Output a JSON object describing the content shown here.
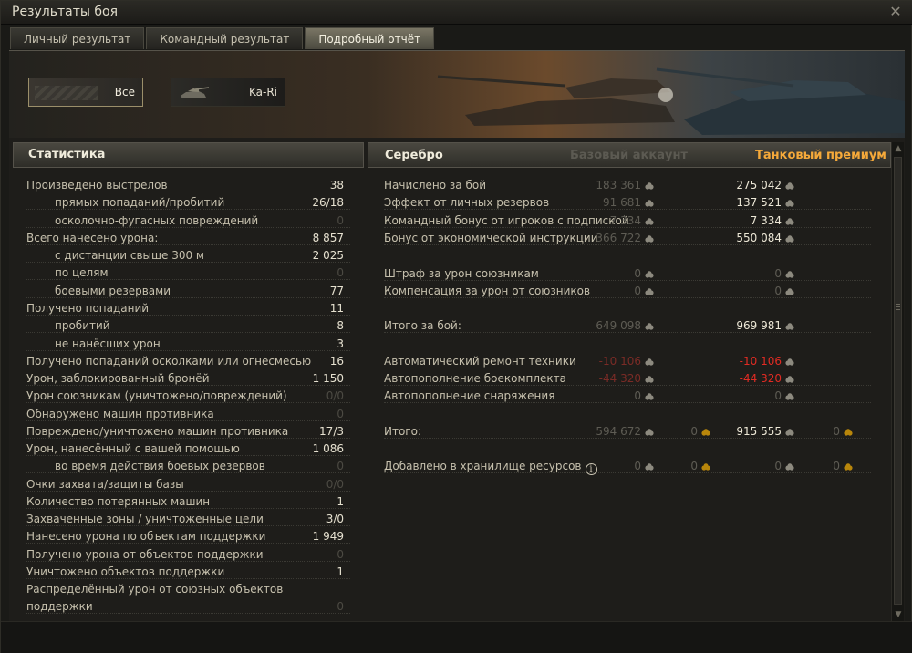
{
  "window": {
    "title": "Результаты боя"
  },
  "tabs": [
    {
      "label": "Личный результат",
      "active": false
    },
    {
      "label": "Командный результат",
      "active": false
    },
    {
      "label": "Подробный отчёт",
      "active": true
    }
  ],
  "filters": [
    {
      "label": "Все",
      "selected": true
    },
    {
      "label": "Ka-Ri",
      "selected": false
    }
  ],
  "stats": {
    "header": "Статистика",
    "rows": [
      {
        "label": "Произведено выстрелов",
        "value": "38",
        "sub": false,
        "dim": false
      },
      {
        "label": "прямых попаданий/пробитий",
        "value": "26/18",
        "sub": true,
        "dim": false
      },
      {
        "label": "осколочно-фугасных повреждений",
        "value": "0",
        "sub": true,
        "dim": true
      },
      {
        "label": "Всего нанесено урона:",
        "value": "8 857",
        "sub": false,
        "dim": false
      },
      {
        "label": "с дистанции свыше 300 м",
        "value": "2 025",
        "sub": true,
        "dim": false
      },
      {
        "label": "по целям",
        "value": "0",
        "sub": true,
        "dim": true
      },
      {
        "label": "боевыми резервами",
        "value": "77",
        "sub": true,
        "dim": false
      },
      {
        "label": "Получено попаданий",
        "value": "11",
        "sub": false,
        "dim": false
      },
      {
        "label": "пробитий",
        "value": "8",
        "sub": true,
        "dim": false
      },
      {
        "label": "не нанёсших урон",
        "value": "3",
        "sub": true,
        "dim": false
      },
      {
        "label": "Получено попаданий осколками или огнесмесью",
        "value": "16",
        "sub": false,
        "dim": false
      },
      {
        "label": "Урон, заблокированный бронёй",
        "value": "1 150",
        "sub": false,
        "dim": false
      },
      {
        "label": "Урон союзникам (уничтожено/повреждений)",
        "value": "0/0",
        "sub": false,
        "dim": true
      },
      {
        "label": "Обнаружено машин противника",
        "value": "0",
        "sub": false,
        "dim": true
      },
      {
        "label": "Повреждено/уничтожено машин противника",
        "value": "17/3",
        "sub": false,
        "dim": false
      },
      {
        "label": "Урон, нанесённый с вашей помощью",
        "value": "1 086",
        "sub": false,
        "dim": false
      },
      {
        "label": "во время действия боевых резервов",
        "value": "0",
        "sub": true,
        "dim": true
      },
      {
        "label": "Очки захвата/защиты базы",
        "value": "0/0",
        "sub": false,
        "dim": true
      },
      {
        "label": "Количество потерянных машин",
        "value": "1",
        "sub": false,
        "dim": false
      },
      {
        "label": "Захваченные зоны / уничтоженные цели",
        "value": "3/0",
        "sub": false,
        "dim": false
      },
      {
        "label": "Нанесено урона по объектам поддержки",
        "value": "1 949",
        "sub": false,
        "dim": false
      },
      {
        "label": "Получено урона от объектов поддержки",
        "value": "0",
        "sub": false,
        "dim": true
      },
      {
        "label": "Уничтожено объектов поддержки",
        "value": "1",
        "sub": false,
        "dim": false
      },
      {
        "label": "Распределённый урон от союзных объектов",
        "value": "",
        "sub": false,
        "dim": false
      },
      {
        "label": "поддержки",
        "value": "0",
        "sub": false,
        "dim": true
      }
    ]
  },
  "silver": {
    "header": "Серебро",
    "col_base": "Базовый аккаунт",
    "col_premium": "Танковый премиум",
    "rows": [
      {
        "label": "Начислено за бой",
        "base": "183 361",
        "premium": "275 042",
        "base_red": false,
        "prem_red": false,
        "prem_dim": false
      },
      {
        "label": "Эффект от личных резервов",
        "base": "91 681",
        "premium": "137 521",
        "base_red": false,
        "prem_red": false,
        "prem_dim": false
      },
      {
        "label": "Командный бонус от игроков с подпиской",
        "base": "7 334",
        "premium": "7 334",
        "base_red": false,
        "prem_red": false,
        "prem_dim": false
      },
      {
        "label": "Бонус от экономической инструкции",
        "base": "366 722",
        "premium": "550 084",
        "base_red": false,
        "prem_red": false,
        "prem_dim": false
      },
      {
        "label": "Штраф за урон союзникам",
        "base": "0",
        "premium": "0",
        "base_red": false,
        "prem_red": false,
        "prem_dim": true
      },
      {
        "label": "Компенсация за урон от союзников",
        "base": "0",
        "premium": "0",
        "base_red": false,
        "prem_red": false,
        "prem_dim": true
      },
      {
        "label": "Итого за бой:",
        "base": "649 098",
        "premium": "969 981",
        "base_red": false,
        "prem_red": false,
        "prem_dim": false
      },
      {
        "label": "Автоматический ремонт техники",
        "base": "-10 106",
        "premium": "-10 106",
        "base_red": true,
        "prem_red": true,
        "prem_dim": false
      },
      {
        "label": "Автопополнение боекомплекта",
        "base": "-44 320",
        "premium": "-44 320",
        "base_red": true,
        "prem_red": true,
        "prem_dim": false
      },
      {
        "label": "Автопополнение снаряжения",
        "base": "0",
        "premium": "0",
        "base_red": false,
        "prem_red": false,
        "prem_dim": true
      },
      {
        "label": "Итого:",
        "base": "594 672",
        "base_gold": "0",
        "premium": "915 555",
        "premium_gold": "0",
        "base_red": false,
        "prem_red": false,
        "prem_dim": false
      },
      {
        "label": "Добавлено в хранилище ресурсов",
        "base": "0",
        "base_gold": "0",
        "premium": "0",
        "premium_gold": "0",
        "base_red": false,
        "prem_red": false,
        "prem_dim": true,
        "info": true
      }
    ]
  },
  "icons": {
    "credits": "credits-icon",
    "gold": "gold-icon",
    "info": "info-icon",
    "close": "close-icon"
  },
  "colors": {
    "premium": "#f5a93a",
    "negative": "#e12b23"
  }
}
